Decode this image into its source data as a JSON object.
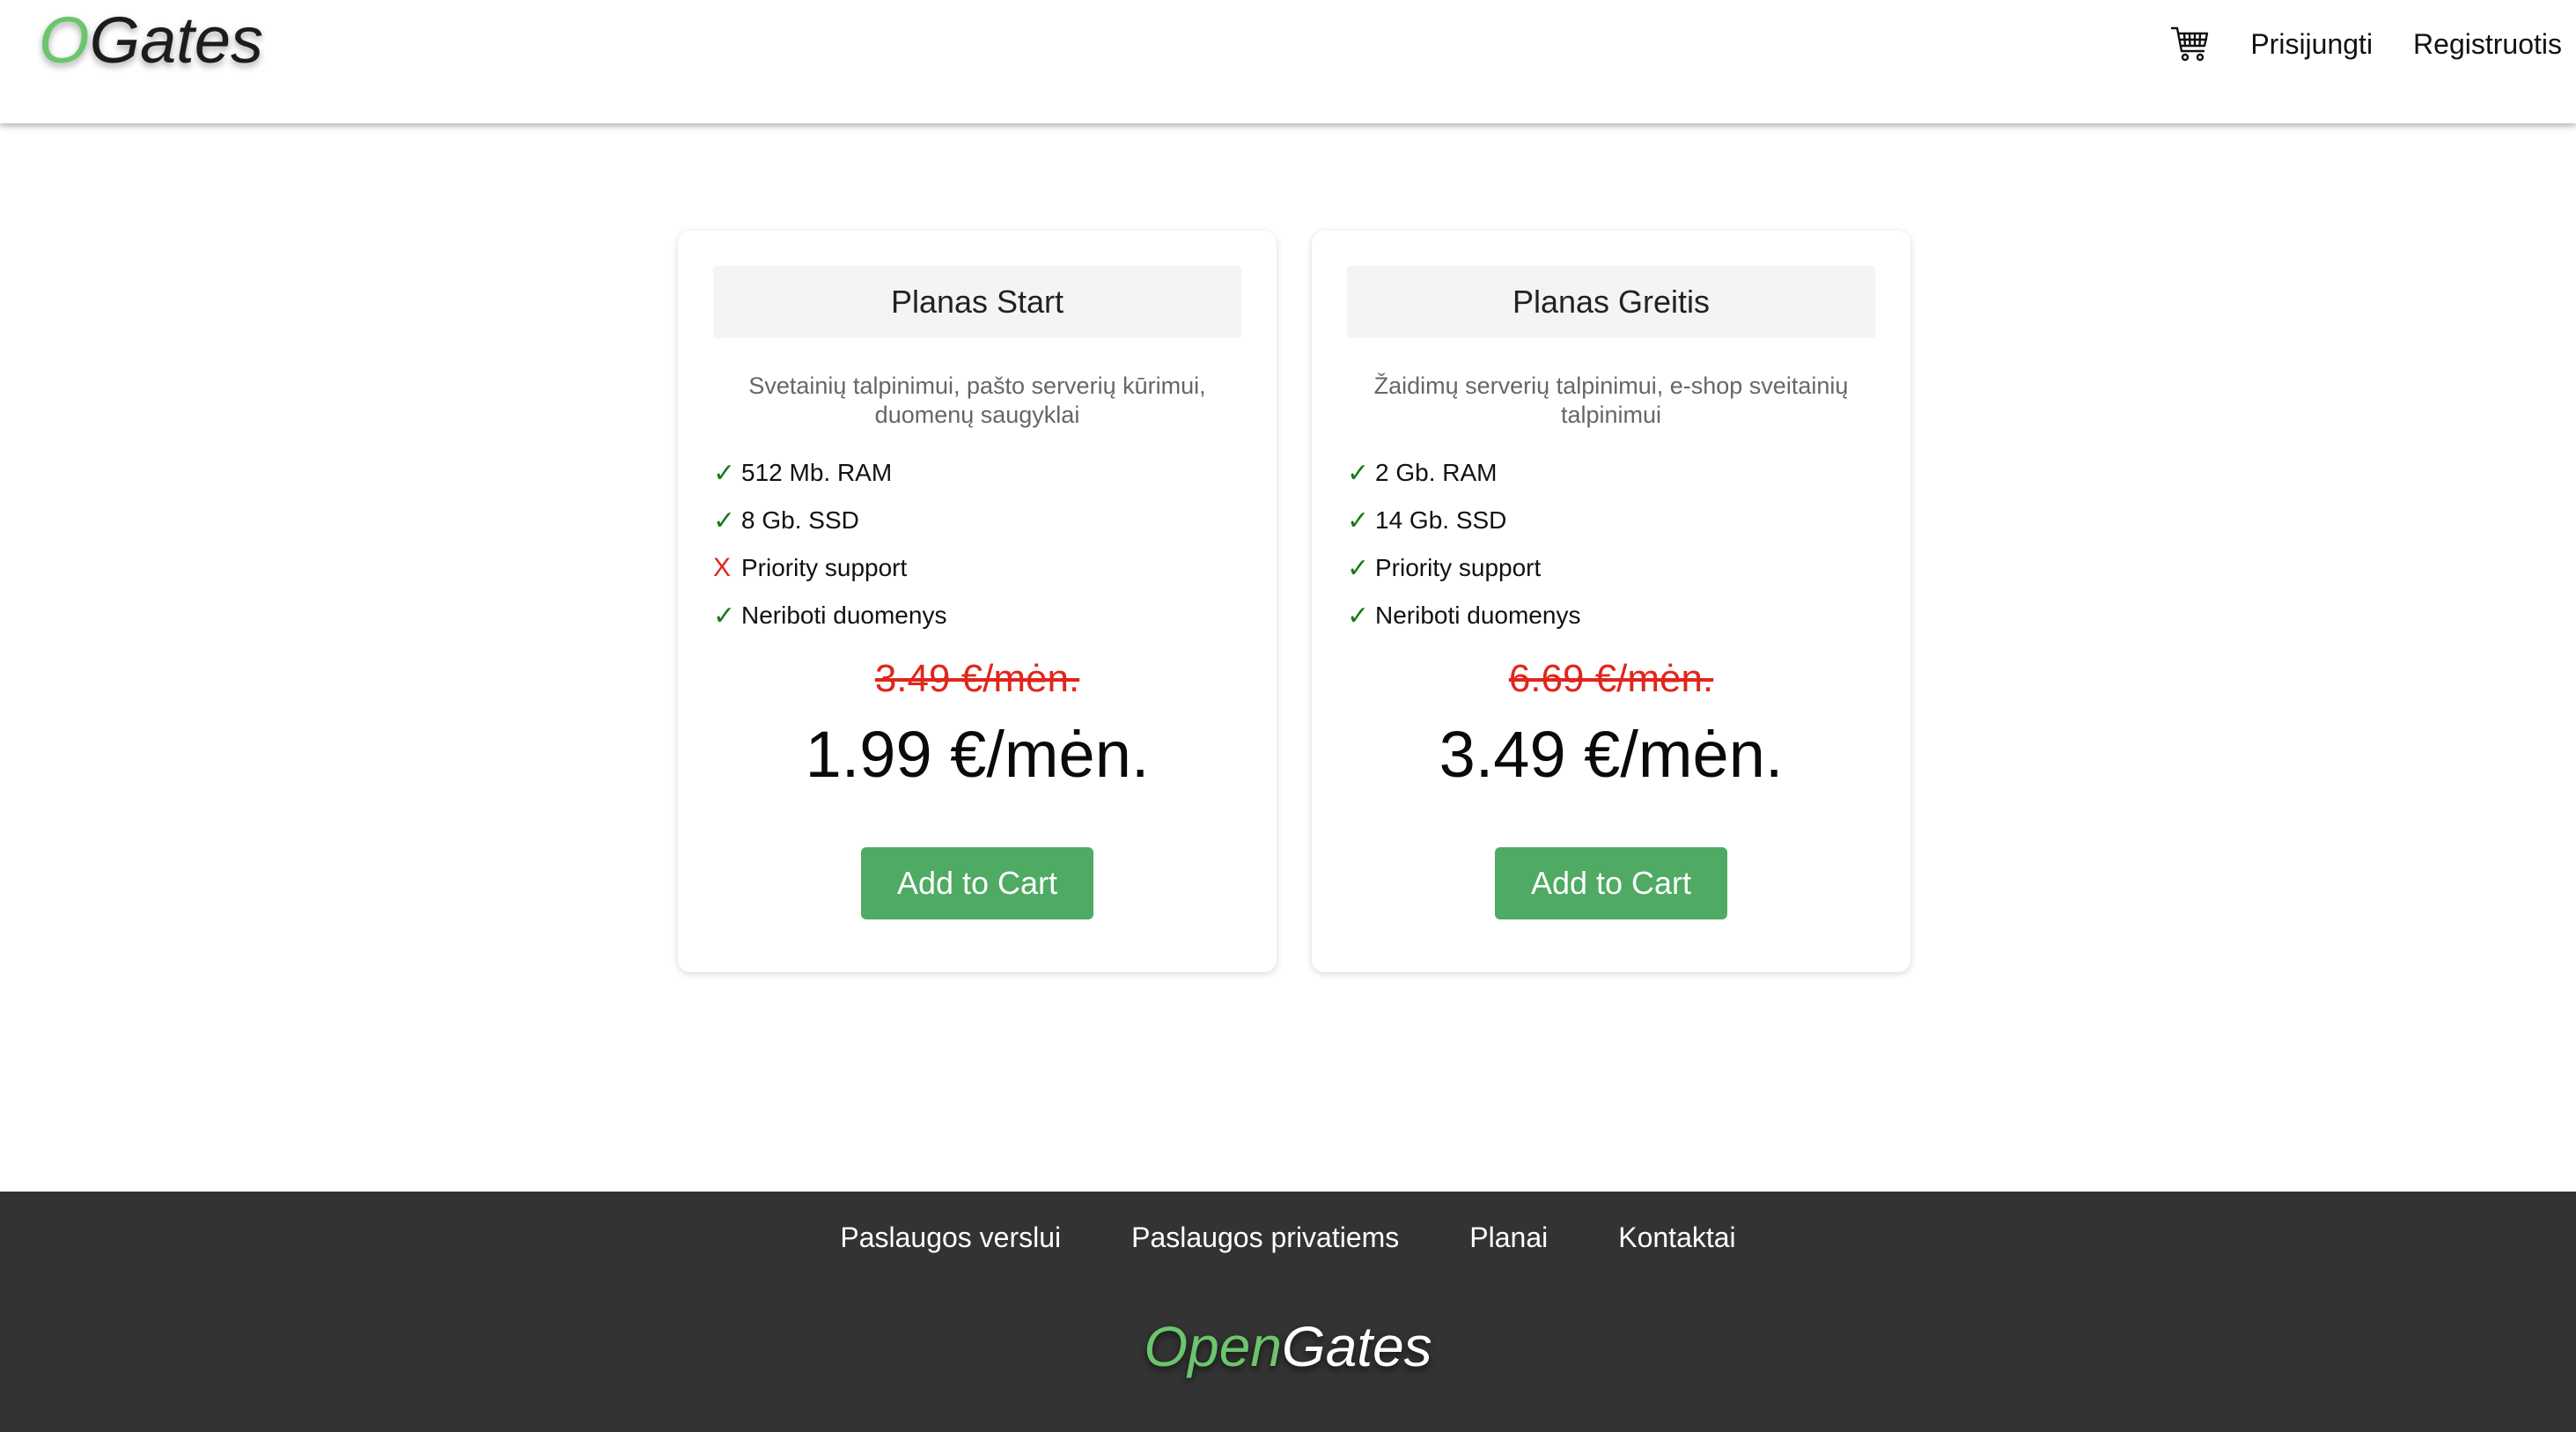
{
  "header": {
    "logo_accent": "O",
    "logo_rest": "Gates",
    "cart_icon": "shopping-cart-icon",
    "login_label": "Prisijungti",
    "register_label": "Registruotis"
  },
  "plans": [
    {
      "title": "Planas Start",
      "description": "Svetainių talpinimui, pašto serverių kūrimui, duomenų saugyklai",
      "features": [
        {
          "mark": "✓",
          "included": true,
          "label": "512 Mb. RAM"
        },
        {
          "mark": "✓",
          "included": true,
          "label": "8 Gb. SSD"
        },
        {
          "mark": "X",
          "included": false,
          "label": "Priority support"
        },
        {
          "mark": "✓",
          "included": true,
          "label": "Neriboti duomenys"
        }
      ],
      "old_price": "3.49 €/mėn.",
      "new_price": "1.99 €/mėn.",
      "button_label": "Add to Cart"
    },
    {
      "title": "Planas Greitis",
      "description": "Žaidimų serverių talpinimui, e-shop sveitainių talpinimui",
      "features": [
        {
          "mark": "✓",
          "included": true,
          "label": "2 Gb. RAM"
        },
        {
          "mark": "✓",
          "included": true,
          "label": "14 Gb. SSD"
        },
        {
          "mark": "✓",
          "included": true,
          "label": "Priority support"
        },
        {
          "mark": "✓",
          "included": true,
          "label": "Neriboti duomenys"
        }
      ],
      "old_price": "6.69 €/mėn.",
      "new_price": "3.49 €/mėn.",
      "button_label": "Add to Cart"
    }
  ],
  "footer": {
    "links": [
      "Paslaugos verslui",
      "Paslaugos privatiems",
      "Planai",
      "Kontaktai"
    ],
    "logo_accent": "Open",
    "logo_rest": "Gates"
  },
  "colors": {
    "accent_green": "#6cc56c",
    "button_green": "#4faa63",
    "strike_red": "#e0261c",
    "check_green": "#1b7a1b",
    "footer_bg": "#333333"
  }
}
